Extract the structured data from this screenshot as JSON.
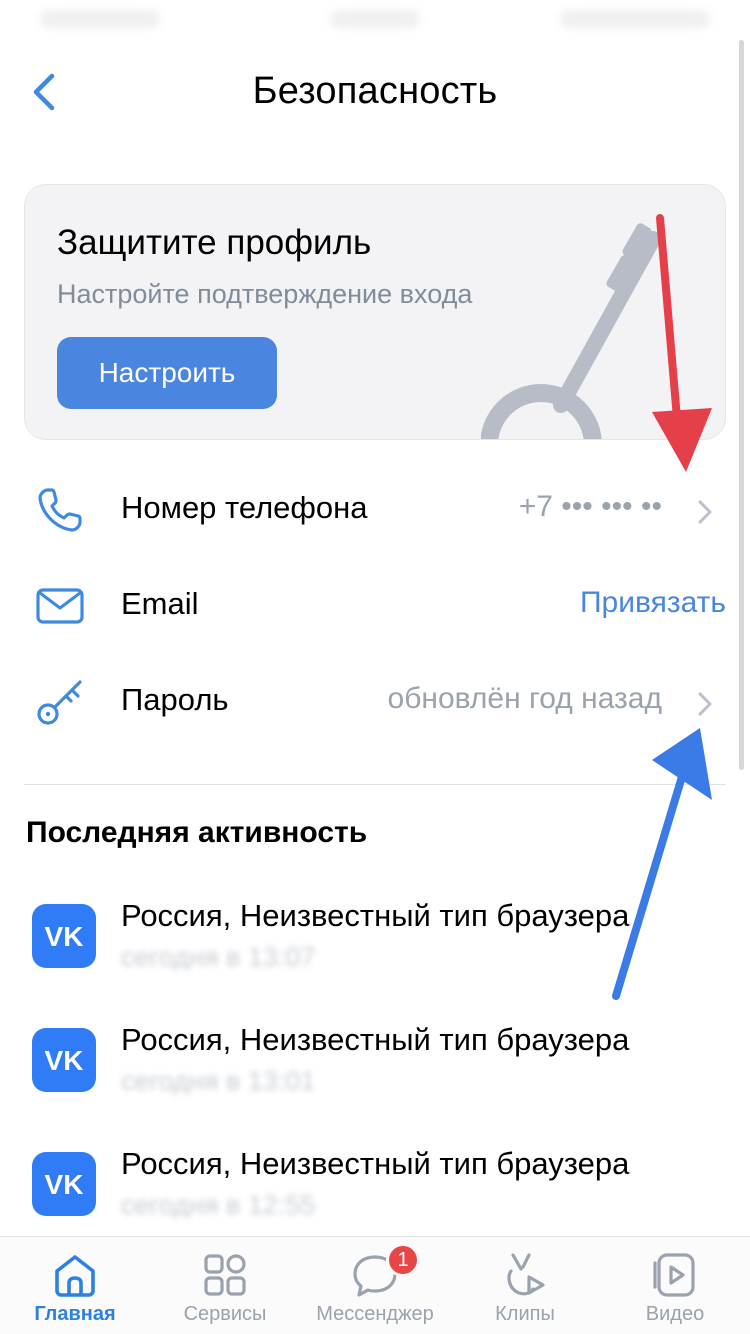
{
  "header": {
    "title": "Безопасность"
  },
  "promo": {
    "title": "Защитите профиль",
    "subtitle": "Настройте подтверждение входа",
    "button_label": "Настроить"
  },
  "settings": {
    "phone": {
      "label": "Номер телефона",
      "value": "+7 ••• ••• ••"
    },
    "email": {
      "label": "Email",
      "action": "Привязать"
    },
    "password": {
      "label": "Пароль",
      "value": "обновлён год назад"
    }
  },
  "activity": {
    "title": "Последняя активность",
    "sessions": [
      {
        "title": "Россия, Неизвестный тип браузера",
        "date": "сегодня в 13:07"
      },
      {
        "title": "Россия, Неизвестный тип браузера",
        "date": "сегодня в 13:01"
      },
      {
        "title": "Россия, Неизвестный тип браузера",
        "date": "сегодня в 12:55"
      }
    ]
  },
  "tabbar": {
    "items": [
      {
        "label": "Главная",
        "icon": "home-icon"
      },
      {
        "label": "Сервисы",
        "icon": "services-icon"
      },
      {
        "label": "Мессенджер",
        "icon": "messenger-icon",
        "badge": "1"
      },
      {
        "label": "Клипы",
        "icon": "clips-icon"
      },
      {
        "label": "Видео",
        "icon": "video-icon"
      }
    ]
  },
  "colors": {
    "accent": "#4a86e0",
    "vk_blue": "#2f7cf6",
    "annotation_red": "#e5404a",
    "annotation_blue": "#3a7be6",
    "badge_red": "#e64646"
  }
}
